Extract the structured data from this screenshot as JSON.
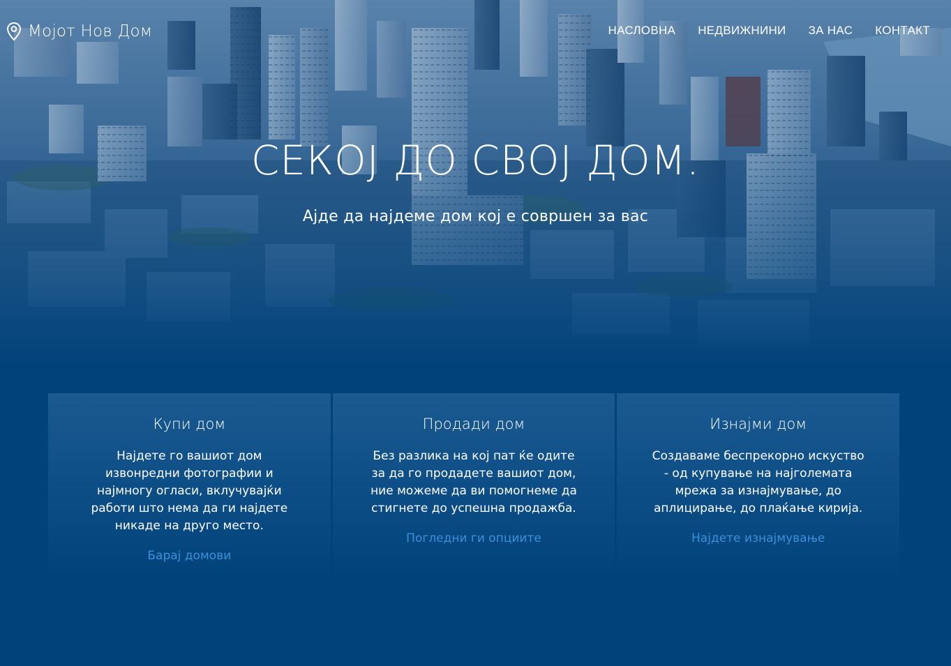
{
  "brand": {
    "name": "Мојот Нов Дом",
    "icon": "location-pin-icon"
  },
  "nav": {
    "items": [
      {
        "label": "НАСЛОВНА"
      },
      {
        "label": "НЕДВИЖНИНИ"
      },
      {
        "label": "ЗА НАС"
      },
      {
        "label": "КОНТАКТ"
      }
    ]
  },
  "hero": {
    "title": "СЕКОЈ ДО СВОЈ ДОМ.",
    "subtitle": "Ајде да најдеме дом кој е совршен за вас"
  },
  "cards": [
    {
      "title": "Купи дом",
      "text": "Најдете го вашиот дом извонредни фотографии и најмногу огласи, вклучувајќи работи што нема да ги најдете никаде на друго место.",
      "link": "Барај домови"
    },
    {
      "title": "Продади дом",
      "text": "Без разлика на кој пат ќе одите за да го продадете вашиот дом, ние можеме да ви помогнеме да стигнете до успешна продажба.",
      "link": "Погледни ги опциите"
    },
    {
      "title": "Изнајми дом",
      "text": "Создаваме беспрекорно искуство - од купување на најголемата мрежа за изнајмување, до аплицирање, до плаќање кирија.",
      "link": "Најдете изнајмување"
    }
  ],
  "colors": {
    "background": "#00427a",
    "card": "#1a5a91",
    "link": "#3d8fd9",
    "text": "#ffffff"
  }
}
